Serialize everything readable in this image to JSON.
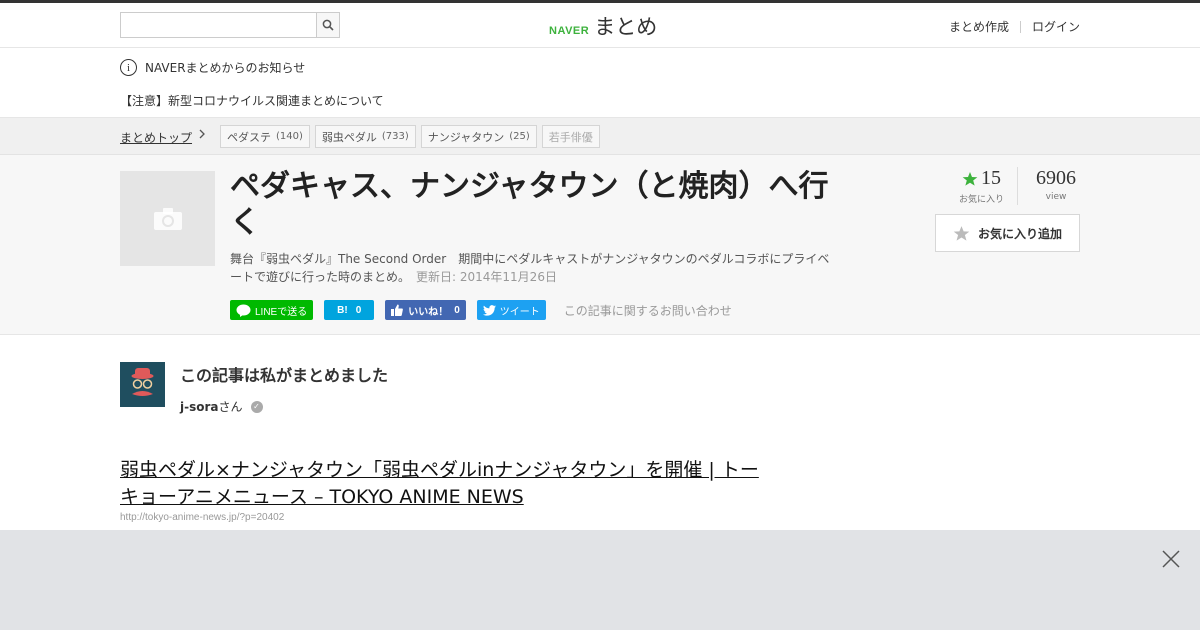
{
  "header": {
    "search": {
      "placeholder": "",
      "value": ""
    },
    "logo_brand": "NAVER",
    "logo_text": "まとめ",
    "nav": {
      "create": "まとめ作成",
      "login": "ログイン"
    }
  },
  "notice": {
    "title": "NAVERまとめからのお知らせ",
    "item": "【注意】新型コロナウイルス関連まとめについて"
  },
  "breadcrumb": {
    "top": "まとめトップ",
    "tags": [
      {
        "label": "ペダステ",
        "count": "(140)"
      },
      {
        "label": "弱虫ペダル",
        "count": "(733)"
      },
      {
        "label": "ナンジャタウン",
        "count": "(25)"
      },
      {
        "label": "若手俳優",
        "count": ""
      }
    ]
  },
  "article": {
    "title": "ペダキャス、ナンジャタウン（と焼肉）へ行く",
    "description": "舞台『弱虫ペダル』The Second Order　期間中にペダルキャストがナンジャタウンのペダルコラボにプライベートで遊びに行った時のまとめ。",
    "updated": "更新日: 2014年11月26日",
    "share": {
      "line": "LINEで送る",
      "hatena_count": "0",
      "fb_label": "いいね！",
      "fb_count": "0",
      "tweet": "ツイート",
      "contact": "この記事に関するお問い合わせ"
    },
    "stats": {
      "fav_count": "15",
      "fav_label": "お気に入り",
      "view_count": "6906",
      "view_label": "view"
    },
    "fav_button": "お気に入り追加"
  },
  "author": {
    "heading": "この記事は私がまとめました",
    "name": "j-sora",
    "suffix": "さん"
  },
  "link": {
    "title": "弱虫ペダル×ナンジャタウン「弱虫ペダルinナンジャタウン」を開催 | トーキョーアニメニュース – TOKYO ANIME NEWS",
    "url": "http://tokyo-anime-news.jp/?p=20402"
  },
  "colors": {
    "naver_green": "#3db23d",
    "line_green": "#00b900",
    "hatena_blue": "#00a4de",
    "facebook_blue": "#4267b2",
    "twitter_blue": "#1da1f2",
    "star_green": "#3db23d"
  },
  "icons": [
    "search-icon",
    "info-icon",
    "chevron-right-icon",
    "camera-icon",
    "line-icon",
    "hatena-icon",
    "facebook-like-icon",
    "twitter-icon",
    "star-icon",
    "verified-icon",
    "close-icon"
  ]
}
